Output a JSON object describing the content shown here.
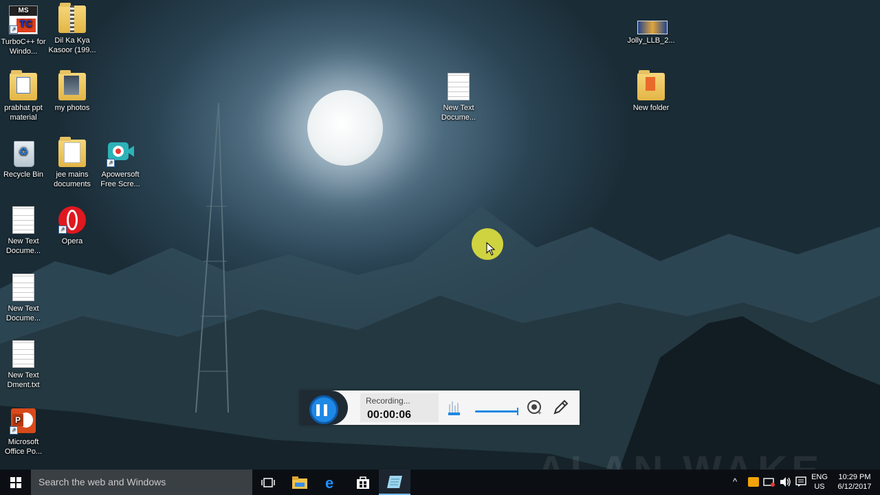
{
  "desktop": {
    "icons": [
      {
        "label": "TurboC++ for Windo..."
      },
      {
        "label": "Dil Ka Kya Kasoor (199..."
      },
      {
        "label": "prabhat ppt material"
      },
      {
        "label": "my photos"
      },
      {
        "label": "Recycle Bin"
      },
      {
        "label": "jee mains documents"
      },
      {
        "label": "Apowersoft Free Scre..."
      },
      {
        "label": "New Text Docume..."
      },
      {
        "label": "Opera"
      },
      {
        "label": "New Text Docume..."
      },
      {
        "label": "New Text Dment.txt"
      },
      {
        "label": "Microsoft Office Po..."
      },
      {
        "label": "New Text Docume..."
      },
      {
        "label": "Jolly_LLB_2..."
      },
      {
        "label": "New folder"
      }
    ],
    "wallpaper_text": "ALAN WAKE"
  },
  "recorder": {
    "status": "Recording...",
    "time": "00:00:06",
    "pause_icon": "pause-icon",
    "accent": "#1e88e5"
  },
  "taskbar": {
    "search_placeholder": "Search the web and Windows",
    "language_top": "ENG",
    "language_bottom": "US",
    "clock_time": "10:29 PM",
    "clock_date": "6/12/2017"
  }
}
